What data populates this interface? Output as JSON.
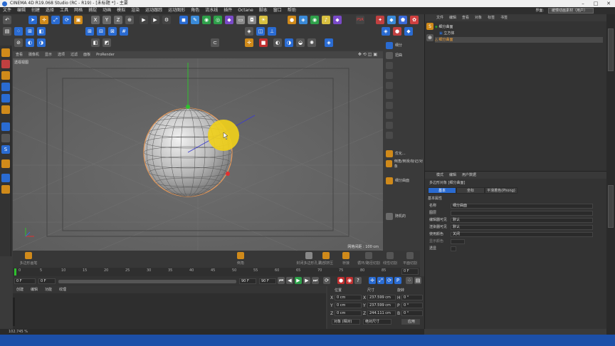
{
  "window": {
    "title": "CINEMA 4D R19.068 Studio (RC - R19) - [未标题 *] - 主要",
    "layout_label": "界面:",
    "layout_value": "缓慢动画素材（用户）"
  },
  "menubar": [
    "文件",
    "编辑",
    "创建",
    "选择",
    "工具",
    "网格",
    "捕捉",
    "动画",
    "模拟",
    "渲染",
    "运动跟踪",
    "运动图形",
    "角色",
    "流水线",
    "插件",
    "Octane",
    "脚本",
    "窗口",
    "帮助"
  ],
  "viewport": {
    "menu": [
      "查看",
      "摄像机",
      "显示",
      "选项",
      "过滤",
      "面板",
      "ProRender"
    ],
    "view_label": "透视视图",
    "grid_label": "网格间距 : 100 cm"
  },
  "right_tools": [
    "细分",
    "扭曲",
    "",
    "",
    "",
    "",
    "",
    "",
    "",
    "",
    "",
    "",
    "",
    "",
    "优化...",
    "倒角/倒滑/标记/对象",
    "",
    "细分曲面",
    "",
    "",
    "",
    "",
    "",
    "随机的",
    "",
    ""
  ],
  "bottom_toolbar": [
    "多边形画笔",
    "",
    "",
    "",
    "",
    "",
    "",
    "",
    "",
    "",
    "",
    "",
    "",
    "",
    "倒角",
    "",
    "",
    "",
    "",
    "封闭多边形孔洞",
    "",
    "",
    "",
    "内部挤压",
    "",
    "",
    "桥接",
    "循环/路径切割",
    "",
    "线性切割",
    "平面切割"
  ],
  "timeline": {
    "ticks": [
      "0",
      "5",
      "10",
      "15",
      "20",
      "25",
      "30",
      "35",
      "40",
      "45",
      "50",
      "55",
      "60",
      "65",
      "70",
      "75",
      "80",
      "85",
      "90"
    ],
    "end": "0 F"
  },
  "transport": {
    "start": "0 F",
    "current": "0 F",
    "end": "90 F",
    "end2": "90 F"
  },
  "material_menu": [
    "创建",
    "编辑",
    "功能",
    "纹理"
  ],
  "coords": {
    "headers": [
      "位置",
      "尺寸",
      "旋转"
    ],
    "rows": [
      {
        "axis": "X",
        "pos": "0 cm",
        "axis2": "X",
        "size": "237.599 cm",
        "rot_axis": "H",
        "rot": "0 °"
      },
      {
        "axis": "Y",
        "pos": "0 cm",
        "axis2": "Y",
        "size": "237.599 cm",
        "rot_axis": "P",
        "rot": "0 °"
      },
      {
        "axis": "Z",
        "pos": "0 cm",
        "axis2": "Z",
        "size": "244.111 cm",
        "rot_axis": "B",
        "rot": "0 °"
      }
    ],
    "mode_dropdown": "对象 (相对)",
    "size_dropdown": "绝对尺寸",
    "apply_label": "应用"
  },
  "status": "102.745 %",
  "object_manager": {
    "menu": [
      "文件",
      "编辑",
      "查看",
      "对象",
      "标签",
      "书签"
    ],
    "objects": [
      "细分曲面",
      "立方体",
      "细分曲面"
    ]
  },
  "attribute_manager": {
    "menu": [
      "模式",
      "编辑",
      "用户数据"
    ],
    "object_title": "多边形对象 [细分曲面]",
    "tabs": [
      "基本",
      "坐标",
      "平滑着色(Phong)"
    ],
    "section": "基本属性",
    "rows": [
      {
        "label": "名称",
        "value": "细分曲面"
      },
      {
        "label": "图层",
        "value": ""
      },
      {
        "label": "编辑器可见",
        "value": "默认"
      },
      {
        "label": "渲染器可见",
        "value": "默认"
      },
      {
        "label": "使用颜色",
        "value": "关闭"
      },
      {
        "label": "显示颜色",
        "value": ""
      },
      {
        "label": "透显",
        "value": ""
      }
    ]
  },
  "colors": {
    "accent_blue": "#2a6bd1",
    "sphere_highlight": "#f2d21a",
    "axis_green": "#2ec02e",
    "axis_red": "#e03030"
  }
}
